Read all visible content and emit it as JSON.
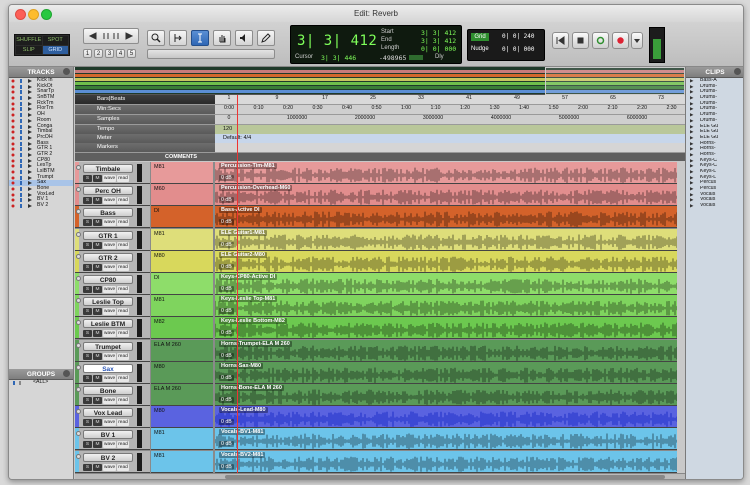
{
  "window": {
    "title": "Edit: Reverb"
  },
  "modes": {
    "shuffle": "SHUFFLE",
    "spot": "SPOT",
    "slip": "SLIP",
    "grid": "GRID"
  },
  "toolbar": {
    "zoom_presets": [
      "1",
      "2",
      "3",
      "4",
      "5"
    ],
    "counter": {
      "main": "3| 3| 412",
      "start_label": "Start",
      "start": "3| 3| 412",
      "end_label": "End",
      "end": "3| 3| 412",
      "length_label": "Length",
      "length": "0| 0| 000",
      "cursor_label": "Cursor",
      "cursor": "3| 3| 446",
      "cursor_offset": "-498965",
      "dly_label": "Dly"
    },
    "grid": {
      "label": "Grid",
      "value": "0| 0| 240",
      "nudge_label": "Nudge",
      "nudge_value": "0| 0| 000"
    }
  },
  "left_panel": {
    "tracks_title": "TRACKS",
    "tracks": [
      "Kick In",
      "KickOt",
      "SnarTp",
      "SnBTM",
      "RckTm",
      "FlorTm",
      "OH",
      "Room",
      "Conga",
      "Timbal",
      "PrcOH",
      "Bass",
      "GTR 1",
      "GTR 2",
      "CP80",
      "LesTp",
      "LslBTM",
      "Trumpt",
      "Sax",
      "Bone",
      "VoxLed",
      "BV 1",
      "BV 2"
    ],
    "selected_track": "Sax",
    "groups_title": "GROUPS",
    "groups": [
      "<ALL>"
    ]
  },
  "right_panel": {
    "clips_title": "CLIPS",
    "clips": [
      "Bass-A",
      "Drums-",
      "Drums-",
      "Drums-",
      "Drums-",
      "Drums-",
      "Drums-",
      "Drums-",
      "ELE Gu",
      "ELE Gu",
      "ELE Gu",
      "Horns-",
      "Horns-",
      "Horns-",
      "Keys-C",
      "Keys-C",
      "Keys-L",
      "Keys-L",
      "Percus",
      "Percus",
      "Vocals",
      "Vocals",
      "Vocals"
    ]
  },
  "rulers": {
    "bars_label": "Bars|Beats",
    "minsec_label": "Min:Secs",
    "samples_label": "Samples",
    "tempo_label": "Tempo",
    "meter_label": "Meter",
    "markers_label": "Markers",
    "bars_ticks": [
      "1",
      "9",
      "17",
      "25",
      "33",
      "41",
      "49",
      "57",
      "65",
      "73"
    ],
    "minsec_ticks": [
      "0:00",
      "0:10",
      "0:20",
      "0:30",
      "0:40",
      "0:50",
      "1:00",
      "1:10",
      "1:20",
      "1:30",
      "1:40",
      "1:50",
      "2:00",
      "2:10",
      "2:20",
      "2:30"
    ],
    "sample_ticks": [
      "0",
      "1000000",
      "2000000",
      "3000000",
      "4000000",
      "5000000",
      "6000000"
    ],
    "tempo_value": "120",
    "meter_value": "Default: 4/4"
  },
  "columns": {
    "comments_label": "COMMENTS"
  },
  "track_buttons": {
    "s": "S",
    "m": "M",
    "wave": "wave",
    "read": "read"
  },
  "tracks": [
    {
      "name": "Timbale",
      "comment": "M81",
      "clip": "Percussion-Tim-M81",
      "gain": "0 dB",
      "color": "#e79a9a"
    },
    {
      "name": "Perc OH",
      "comment": "M60",
      "clip": "Percussion-Overhead-M60",
      "gain": "0 dB",
      "color": "#e28d8d"
    },
    {
      "name": "Bass",
      "comment": "DI",
      "clip": "Bass-Active DI",
      "gain": "0 dB",
      "color": "#d4622a"
    },
    {
      "name": "GTR 1",
      "comment": "M81",
      "clip": "ELE Guitar1-M81",
      "gain": "0 dB",
      "color": "#dede7a"
    },
    {
      "name": "GTR 2",
      "comment": "M80",
      "clip": "ELE Guitar2-M80",
      "gain": "0 dB",
      "color": "#d8d85c"
    },
    {
      "name": "CP80",
      "comment": "DI",
      "clip": "Keys-CP80-Active DI",
      "gain": "0 dB",
      "color": "#8edd6a"
    },
    {
      "name": "Leslie Top",
      "comment": "M81",
      "clip": "Keys-Leslie Top-M81",
      "gain": "0 dB",
      "color": "#7fd45e"
    },
    {
      "name": "Leslie BTM",
      "comment": "M82",
      "clip": "Keys-Leslie Bottom-M82",
      "gain": "0 dB",
      "color": "#6cc94f"
    },
    {
      "name": "Trumpet",
      "comment": "ELA M 260",
      "clip": "Horns-Trumpet-ELA M 260",
      "gain": "0 dB",
      "color": "#5a9a58"
    },
    {
      "name": "Sax",
      "comment": "M80",
      "clip": "Horns-Sax-M80",
      "gain": "0 dB",
      "color": "#5a9a58"
    },
    {
      "name": "Bone",
      "comment": "ELA M 260",
      "clip": "Horns-Bone-ELA M 260",
      "gain": "0 dB",
      "color": "#5a9a58"
    },
    {
      "name": "Vox Lead",
      "comment": "M80",
      "clip": "Vocals-Lead-M80",
      "gain": "0 dB",
      "color": "#5a63e0"
    },
    {
      "name": "BV 1",
      "comment": "M81",
      "clip": "Vocals-BV1-M81",
      "gain": "0 dB",
      "color": "#6cc4ea"
    },
    {
      "name": "BV 2",
      "comment": "M81",
      "clip": "Vocals-BV2-M81",
      "gain": "0 dB",
      "color": "#6cc4ea"
    }
  ]
}
